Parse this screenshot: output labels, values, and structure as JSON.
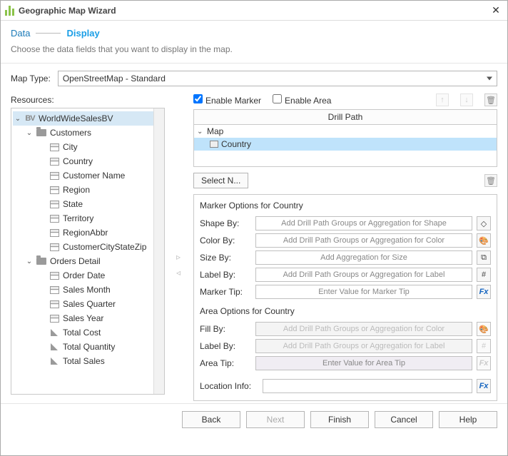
{
  "window": {
    "title": "Geographic Map Wizard"
  },
  "steps": {
    "data": "Data",
    "display": "Display"
  },
  "subtitle": "Choose the data fields that you want to display in the map.",
  "maptype": {
    "label": "Map Type:",
    "value": "OpenStreetMap - Standard"
  },
  "resources_label": "Resources:",
  "tree": {
    "root": "WorldWideSalesBV",
    "customers": {
      "label": "Customers",
      "items": [
        "City",
        "Country",
        "Customer Name",
        "Region",
        "State",
        "Territory",
        "RegionAbbr",
        "CustomerCityStateZip"
      ]
    },
    "orders": {
      "label": "Orders Detail",
      "items": [
        "Order Date",
        "Sales Month",
        "Sales Quarter",
        "Sales Year",
        "Total Cost",
        "Total Quantity",
        "Total Sales"
      ]
    }
  },
  "enable": {
    "marker": "Enable Marker",
    "area": "Enable Area",
    "marker_checked": true,
    "area_checked": false
  },
  "drill": {
    "header": "Drill Path",
    "root": "Map",
    "child": "Country"
  },
  "select_name": "Select N...",
  "marker_opts": {
    "title": "Marker Options for Country",
    "shape": {
      "label": "Shape By:",
      "placeholder": "Add Drill Path Groups or Aggregation for Shape"
    },
    "color": {
      "label": "Color By:",
      "placeholder": "Add Drill Path Groups or Aggregation for Color"
    },
    "size": {
      "label": "Size By:",
      "placeholder": "Add Aggregation for Size"
    },
    "labelby": {
      "label": "Label By:",
      "placeholder": "Add Drill Path Groups or Aggregation for Label"
    },
    "tip": {
      "label": "Marker Tip:",
      "placeholder": "Enter Value for Marker Tip"
    }
  },
  "area_opts": {
    "title": "Area Options for Country",
    "fill": {
      "label": "Fill By:",
      "placeholder": "Add Drill Path Groups or Aggregation for Color"
    },
    "labelby": {
      "label": "Label By:",
      "placeholder": "Add Drill Path Groups or Aggregation for Label"
    },
    "tip": {
      "label": "Area Tip:",
      "placeholder": "Enter Value for Area Tip"
    }
  },
  "location": {
    "label": "Location Info:"
  },
  "footer": {
    "back": "Back",
    "next": "Next",
    "finish": "Finish",
    "cancel": "Cancel",
    "help": "Help"
  },
  "icons": {
    "shape": "�отр"
  }
}
